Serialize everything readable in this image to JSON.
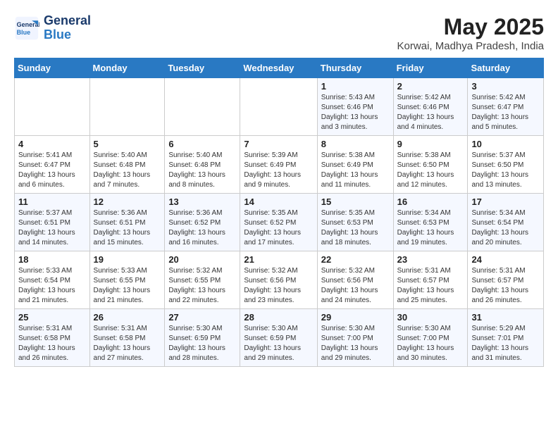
{
  "header": {
    "logo_line1": "General",
    "logo_line2": "Blue",
    "month_year": "May 2025",
    "location": "Korwai, Madhya Pradesh, India"
  },
  "weekdays": [
    "Sunday",
    "Monday",
    "Tuesday",
    "Wednesday",
    "Thursday",
    "Friday",
    "Saturday"
  ],
  "weeks": [
    [
      {
        "day": "",
        "content": ""
      },
      {
        "day": "",
        "content": ""
      },
      {
        "day": "",
        "content": ""
      },
      {
        "day": "",
        "content": ""
      },
      {
        "day": "1",
        "content": "Sunrise: 5:43 AM\nSunset: 6:46 PM\nDaylight: 13 hours\nand 3 minutes."
      },
      {
        "day": "2",
        "content": "Sunrise: 5:42 AM\nSunset: 6:46 PM\nDaylight: 13 hours\nand 4 minutes."
      },
      {
        "day": "3",
        "content": "Sunrise: 5:42 AM\nSunset: 6:47 PM\nDaylight: 13 hours\nand 5 minutes."
      }
    ],
    [
      {
        "day": "4",
        "content": "Sunrise: 5:41 AM\nSunset: 6:47 PM\nDaylight: 13 hours\nand 6 minutes."
      },
      {
        "day": "5",
        "content": "Sunrise: 5:40 AM\nSunset: 6:48 PM\nDaylight: 13 hours\nand 7 minutes."
      },
      {
        "day": "6",
        "content": "Sunrise: 5:40 AM\nSunset: 6:48 PM\nDaylight: 13 hours\nand 8 minutes."
      },
      {
        "day": "7",
        "content": "Sunrise: 5:39 AM\nSunset: 6:49 PM\nDaylight: 13 hours\nand 9 minutes."
      },
      {
        "day": "8",
        "content": "Sunrise: 5:38 AM\nSunset: 6:49 PM\nDaylight: 13 hours\nand 11 minutes."
      },
      {
        "day": "9",
        "content": "Sunrise: 5:38 AM\nSunset: 6:50 PM\nDaylight: 13 hours\nand 12 minutes."
      },
      {
        "day": "10",
        "content": "Sunrise: 5:37 AM\nSunset: 6:50 PM\nDaylight: 13 hours\nand 13 minutes."
      }
    ],
    [
      {
        "day": "11",
        "content": "Sunrise: 5:37 AM\nSunset: 6:51 PM\nDaylight: 13 hours\nand 14 minutes."
      },
      {
        "day": "12",
        "content": "Sunrise: 5:36 AM\nSunset: 6:51 PM\nDaylight: 13 hours\nand 15 minutes."
      },
      {
        "day": "13",
        "content": "Sunrise: 5:36 AM\nSunset: 6:52 PM\nDaylight: 13 hours\nand 16 minutes."
      },
      {
        "day": "14",
        "content": "Sunrise: 5:35 AM\nSunset: 6:52 PM\nDaylight: 13 hours\nand 17 minutes."
      },
      {
        "day": "15",
        "content": "Sunrise: 5:35 AM\nSunset: 6:53 PM\nDaylight: 13 hours\nand 18 minutes."
      },
      {
        "day": "16",
        "content": "Sunrise: 5:34 AM\nSunset: 6:53 PM\nDaylight: 13 hours\nand 19 minutes."
      },
      {
        "day": "17",
        "content": "Sunrise: 5:34 AM\nSunset: 6:54 PM\nDaylight: 13 hours\nand 20 minutes."
      }
    ],
    [
      {
        "day": "18",
        "content": "Sunrise: 5:33 AM\nSunset: 6:54 PM\nDaylight: 13 hours\nand 21 minutes."
      },
      {
        "day": "19",
        "content": "Sunrise: 5:33 AM\nSunset: 6:55 PM\nDaylight: 13 hours\nand 21 minutes."
      },
      {
        "day": "20",
        "content": "Sunrise: 5:32 AM\nSunset: 6:55 PM\nDaylight: 13 hours\nand 22 minutes."
      },
      {
        "day": "21",
        "content": "Sunrise: 5:32 AM\nSunset: 6:56 PM\nDaylight: 13 hours\nand 23 minutes."
      },
      {
        "day": "22",
        "content": "Sunrise: 5:32 AM\nSunset: 6:56 PM\nDaylight: 13 hours\nand 24 minutes."
      },
      {
        "day": "23",
        "content": "Sunrise: 5:31 AM\nSunset: 6:57 PM\nDaylight: 13 hours\nand 25 minutes."
      },
      {
        "day": "24",
        "content": "Sunrise: 5:31 AM\nSunset: 6:57 PM\nDaylight: 13 hours\nand 26 minutes."
      }
    ],
    [
      {
        "day": "25",
        "content": "Sunrise: 5:31 AM\nSunset: 6:58 PM\nDaylight: 13 hours\nand 26 minutes."
      },
      {
        "day": "26",
        "content": "Sunrise: 5:31 AM\nSunset: 6:58 PM\nDaylight: 13 hours\nand 27 minutes."
      },
      {
        "day": "27",
        "content": "Sunrise: 5:30 AM\nSunset: 6:59 PM\nDaylight: 13 hours\nand 28 minutes."
      },
      {
        "day": "28",
        "content": "Sunrise: 5:30 AM\nSunset: 6:59 PM\nDaylight: 13 hours\nand 29 minutes."
      },
      {
        "day": "29",
        "content": "Sunrise: 5:30 AM\nSunset: 7:00 PM\nDaylight: 13 hours\nand 29 minutes."
      },
      {
        "day": "30",
        "content": "Sunrise: 5:30 AM\nSunset: 7:00 PM\nDaylight: 13 hours\nand 30 minutes."
      },
      {
        "day": "31",
        "content": "Sunrise: 5:29 AM\nSunset: 7:01 PM\nDaylight: 13 hours\nand 31 minutes."
      }
    ]
  ]
}
